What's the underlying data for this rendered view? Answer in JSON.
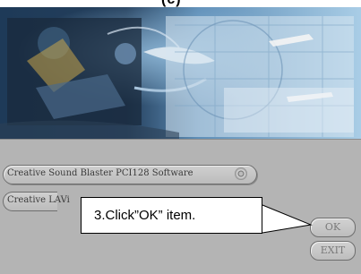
{
  "heading_fragment": "(c)",
  "software_items": [
    {
      "label": "Creative Sound Blaster PCI128 Software"
    },
    {
      "label": "Creative LAVi"
    }
  ],
  "callout": {
    "text": "3.Click”OK” item."
  },
  "buttons": {
    "ok": "OK",
    "exit": "EXIT"
  }
}
